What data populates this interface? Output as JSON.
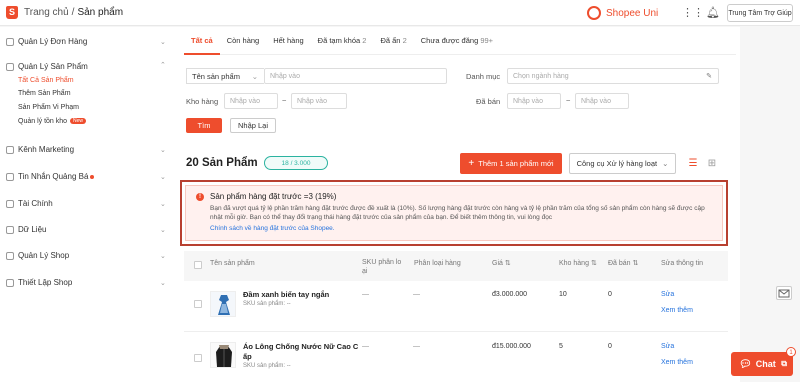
{
  "header": {
    "home": "Trang chủ",
    "separator": "/",
    "current": "Sản phẩm",
    "uni_label": "Shopee Uni",
    "help_label": "Trung Tâm Trợ Giúp"
  },
  "sidebar": {
    "order_label": "Quản Lý Đơn Hàng",
    "product_label": "Quản Lý Sản Phẩm",
    "product_items": [
      "Tất Cả Sản Phẩm",
      "Thêm Sản Phẩm",
      "Sản Phẩm Vi Phạm",
      "Quản lý tồn kho"
    ],
    "new_badge": "New",
    "marketing_label": "Kênh Marketing",
    "ads_label": "Tin Nhắn Quảng Bá",
    "finance_label": "Tài Chính",
    "data_label": "Dữ Liệu",
    "shop_label": "Quản Lý Shop",
    "settings_label": "Thiết Lập Shop"
  },
  "tabs": [
    {
      "label": "Tất cả",
      "count": ""
    },
    {
      "label": "Còn hàng",
      "count": ""
    },
    {
      "label": "Hết hàng",
      "count": ""
    },
    {
      "label": "Đã tạm khóa",
      "count": "2"
    },
    {
      "label": "Đã ẩn",
      "count": "2"
    },
    {
      "label": "Chưa được đăng",
      "count": "99+"
    }
  ],
  "filters": {
    "name_select": "Tên sản phẩm",
    "name_placeholder": "Nhập vào",
    "category_label": "Danh mục",
    "category_placeholder": "Chọn ngành hàng",
    "stock_label": "Kho hàng",
    "stock_min_placeholder": "Nhập vào",
    "stock_max_placeholder": "Nhập vào",
    "range_sep": "~",
    "sold_label": "Đã bán",
    "sold_min_placeholder": "Nhập vào",
    "sold_max_placeholder": "Nhập vào",
    "search_button": "Tìm",
    "reset_button": "Nhập Lại"
  },
  "summary": {
    "count_title": "20 Sản Phẩm",
    "quota": "18 / 3.000",
    "add_button": "Thêm 1 sản phẩm mới",
    "bulk_button": "Công cụ Xử lý hàng loạt"
  },
  "alert": {
    "title": "Sản phẩm hàng đặt trước =3 (19%)",
    "body": "Bạn đã vượt quá tỷ lệ phần trăm hàng đặt trước được đề xuất là (10%). Số lượng hàng đặt trước còn hàng và tỷ lệ phần trăm của tổng số sản phẩm còn hàng sẽ được cập nhật mỗi giờ. Bạn có thể thay đổi trạng thái hàng đặt trước của sản phẩm của bạn. Để biết thêm thông tin, vui lòng đọc",
    "link": "Chính sách về hàng đặt trước của Shopee."
  },
  "table": {
    "headers": {
      "name": "Tên sản phẩm",
      "sku_1": "SKU phân lo",
      "sku_2": "ại",
      "variant": "Phân loại hàng",
      "price": "Giá",
      "stock": "Kho hàng",
      "sold": "Đã bán",
      "edit": "Sửa thông tin"
    },
    "rows": [
      {
        "name": "Đầm xanh biển tay ngắn",
        "sku": "SKU sản phẩm: --",
        "sku_var": "—",
        "variant": "—",
        "price": "đ3.000.000",
        "stock": "10",
        "sold": "0",
        "edit": "Sửa",
        "more": "Xem thêm"
      },
      {
        "name_1": "Áo Lông Chống Nước Nữ Cao C",
        "name_2": "ấp",
        "sku": "SKU sản phẩm: --",
        "sku_var": "—",
        "variant": "—",
        "price": "đ15.000.000",
        "stock": "5",
        "sold": "0",
        "edit": "Sửa",
        "more": "Xem thêm"
      }
    ]
  },
  "chat": {
    "label": "Chat",
    "badge": "1"
  },
  "colors": {
    "accent": "#ee4d2d",
    "link": "#2673dd",
    "teal": "#2bb3a0",
    "alert_border": "#b84030"
  }
}
